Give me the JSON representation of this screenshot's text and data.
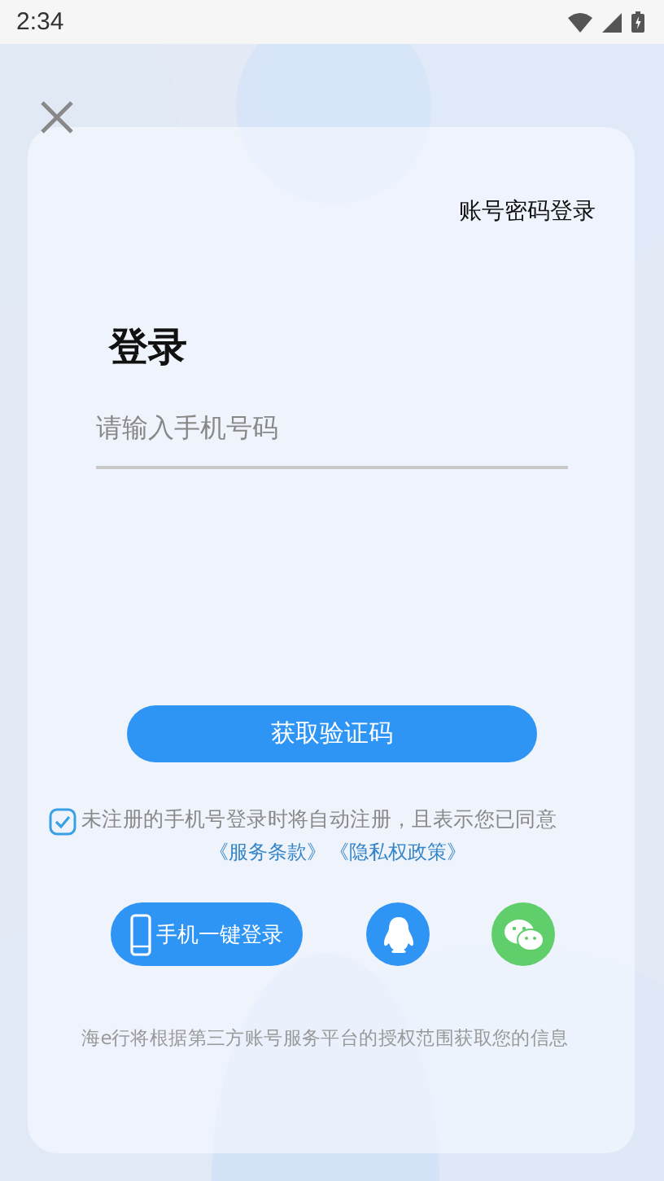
{
  "status_bar": {
    "time": "2:34"
  },
  "password_login_link": "账号密码登录",
  "title": "登录",
  "phone_field": {
    "placeholder": "请输入手机号码"
  },
  "get_code_button": "获取验证码",
  "agreement": {
    "checked": true,
    "text": "未注册的手机号登录时将自动注册，且表示您已同意",
    "links": [
      "《服务条款》",
      "《隐私权政策》"
    ]
  },
  "social": [
    {
      "kind": "phone",
      "label": "手机一键登录"
    },
    {
      "kind": "qq"
    },
    {
      "kind": "wechat"
    }
  ],
  "footer": "海e行将根据第三方账号服务平台的授权范围获取您的信息"
}
